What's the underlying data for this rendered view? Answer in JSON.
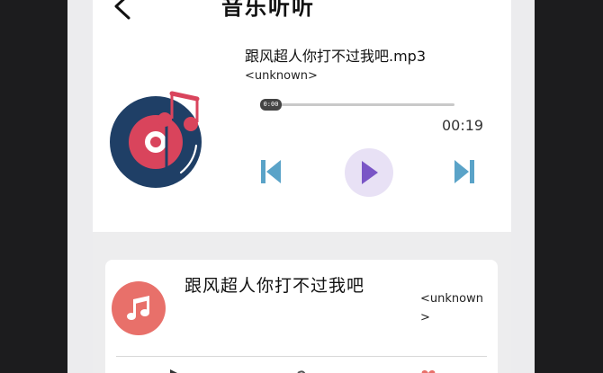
{
  "header": {
    "title": "音乐听听",
    "back_icon": "chevron-left-icon"
  },
  "player": {
    "song_title": "跟风超人你打不过我吧.mp3",
    "artist": "<unknown>",
    "current_time": "0:00",
    "duration": "00:19",
    "progress": 0.0,
    "disc_icon": "vinyl-record-icon",
    "controls": {
      "prev_icon": "skip-previous-icon",
      "play_icon": "play-icon",
      "next_icon": "skip-next-icon"
    },
    "colors": {
      "disc": "#1f3f66",
      "accent": "#d9445c",
      "control_blue": "#5aa3c8",
      "play_purple": "#7a55c6",
      "play_bg": "#e8e1f5"
    }
  },
  "playlist": {
    "items": [
      {
        "title": "跟风超人你打不过我吧",
        "artist": "<unknown>",
        "icon": "music-note-icon",
        "icon_color": "#e8706a"
      }
    ]
  }
}
